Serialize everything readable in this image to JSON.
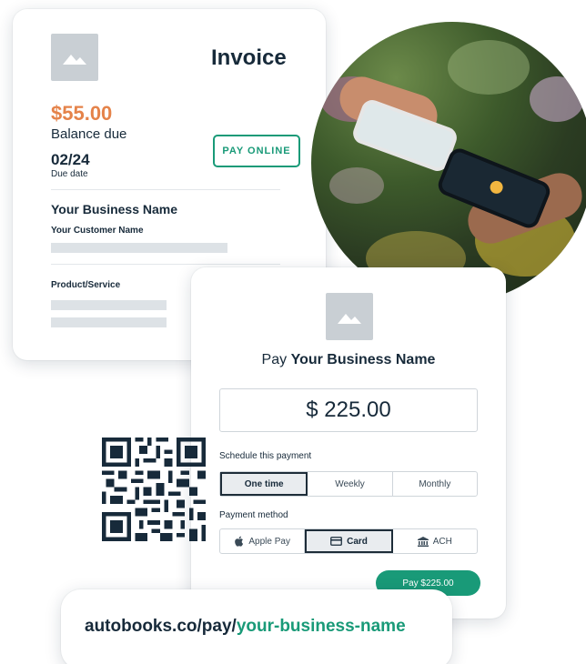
{
  "invoice": {
    "title": "Invoice",
    "amount": "$55.00",
    "balance_label": "Balance due",
    "due_date": "02/24",
    "due_date_label": "Due date",
    "pay_online_label": "PAY ONLINE",
    "business_name": "Your Business Name",
    "customer_name": "Your Customer Name",
    "product_label": "Product/Service"
  },
  "payment": {
    "title_prefix": "Pay",
    "business_name": "Your Business Name",
    "amount": "$ 225.00",
    "schedule_label": "Schedule this payment",
    "schedule_options": [
      "One time",
      "Weekly",
      "Monthly"
    ],
    "schedule_selected": "One time",
    "method_label": "Payment method",
    "method_options": [
      "Apple Pay",
      "Card",
      "ACH"
    ],
    "method_selected": "Card",
    "pay_button_label": "Pay $225.00"
  },
  "url": {
    "base": "autobooks.co/pay/",
    "slug": "your-business-name"
  },
  "colors": {
    "accent_green": "#199a78",
    "amount_orange": "#e5834a",
    "text_dark": "#172a3a"
  },
  "icons": [
    "image-placeholder-icon",
    "apple-icon",
    "card-icon",
    "bank-icon",
    "qr-code"
  ]
}
